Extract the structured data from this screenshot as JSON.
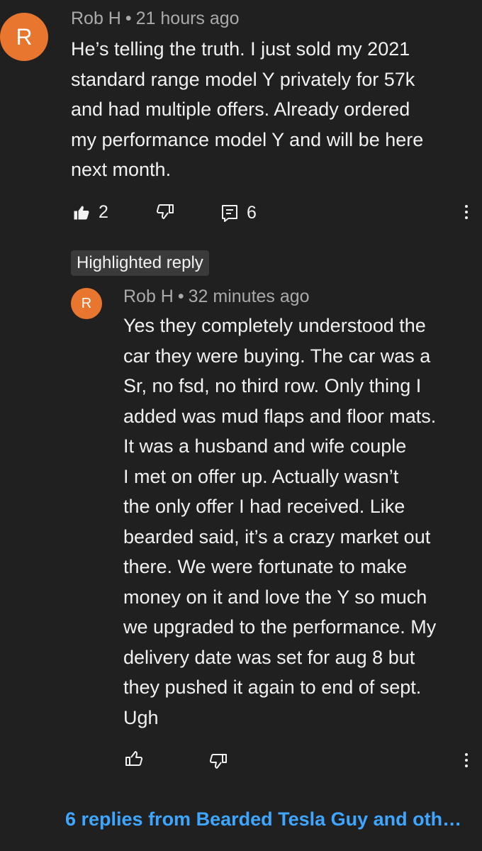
{
  "comment": {
    "avatar_letter": "R",
    "author": "Rob H",
    "separator": "•",
    "time": "21 hours ago",
    "lines": [
      "He’s telling the truth. I just sold my 2021",
      "standard range model Y privately for 57k",
      "and had multiple offers. Already ordered",
      "my performance model Y and will be here",
      "next month."
    ],
    "likes": "2",
    "replies_count": "6",
    "icons": {
      "like": "thumbs-up-filled-icon",
      "dislike": "thumbs-down-icon",
      "reply": "reply-comment-icon",
      "menu": "more-vertical-icon"
    }
  },
  "highlighted_label": "Highlighted reply",
  "reply": {
    "avatar_letter": "R",
    "author": "Rob H",
    "separator": "•",
    "time": "32 minutes ago",
    "lines": [
      "Yes they completely understood the",
      "car they were buying. The car was a",
      "Sr, no fsd, no third row. Only thing I",
      "added was mud flaps and floor mats.",
      "It was a husband and wife couple",
      "I met on offer up. Actually wasn’t",
      "the only offer I had received. Like",
      "bearded said, it’s a crazy market out",
      "there. We were fortunate to make",
      "money on it and love the Y so much",
      "we upgraded to the performance. My",
      "delivery date was set for aug 8 but",
      "they pushed it again to end of sept.",
      "Ugh"
    ],
    "icons": {
      "like": "thumbs-up-outline-icon",
      "dislike": "thumbs-down-icon",
      "menu": "more-vertical-icon"
    }
  },
  "view_replies": "6 replies from Bearded Tesla Guy and oth…",
  "colors": {
    "background": "#202020",
    "text": "#f1f1f1",
    "meta": "#aaaaaa",
    "avatar": "#e8762e",
    "link": "#3ea6ff",
    "chip": "#3a3a3a"
  }
}
